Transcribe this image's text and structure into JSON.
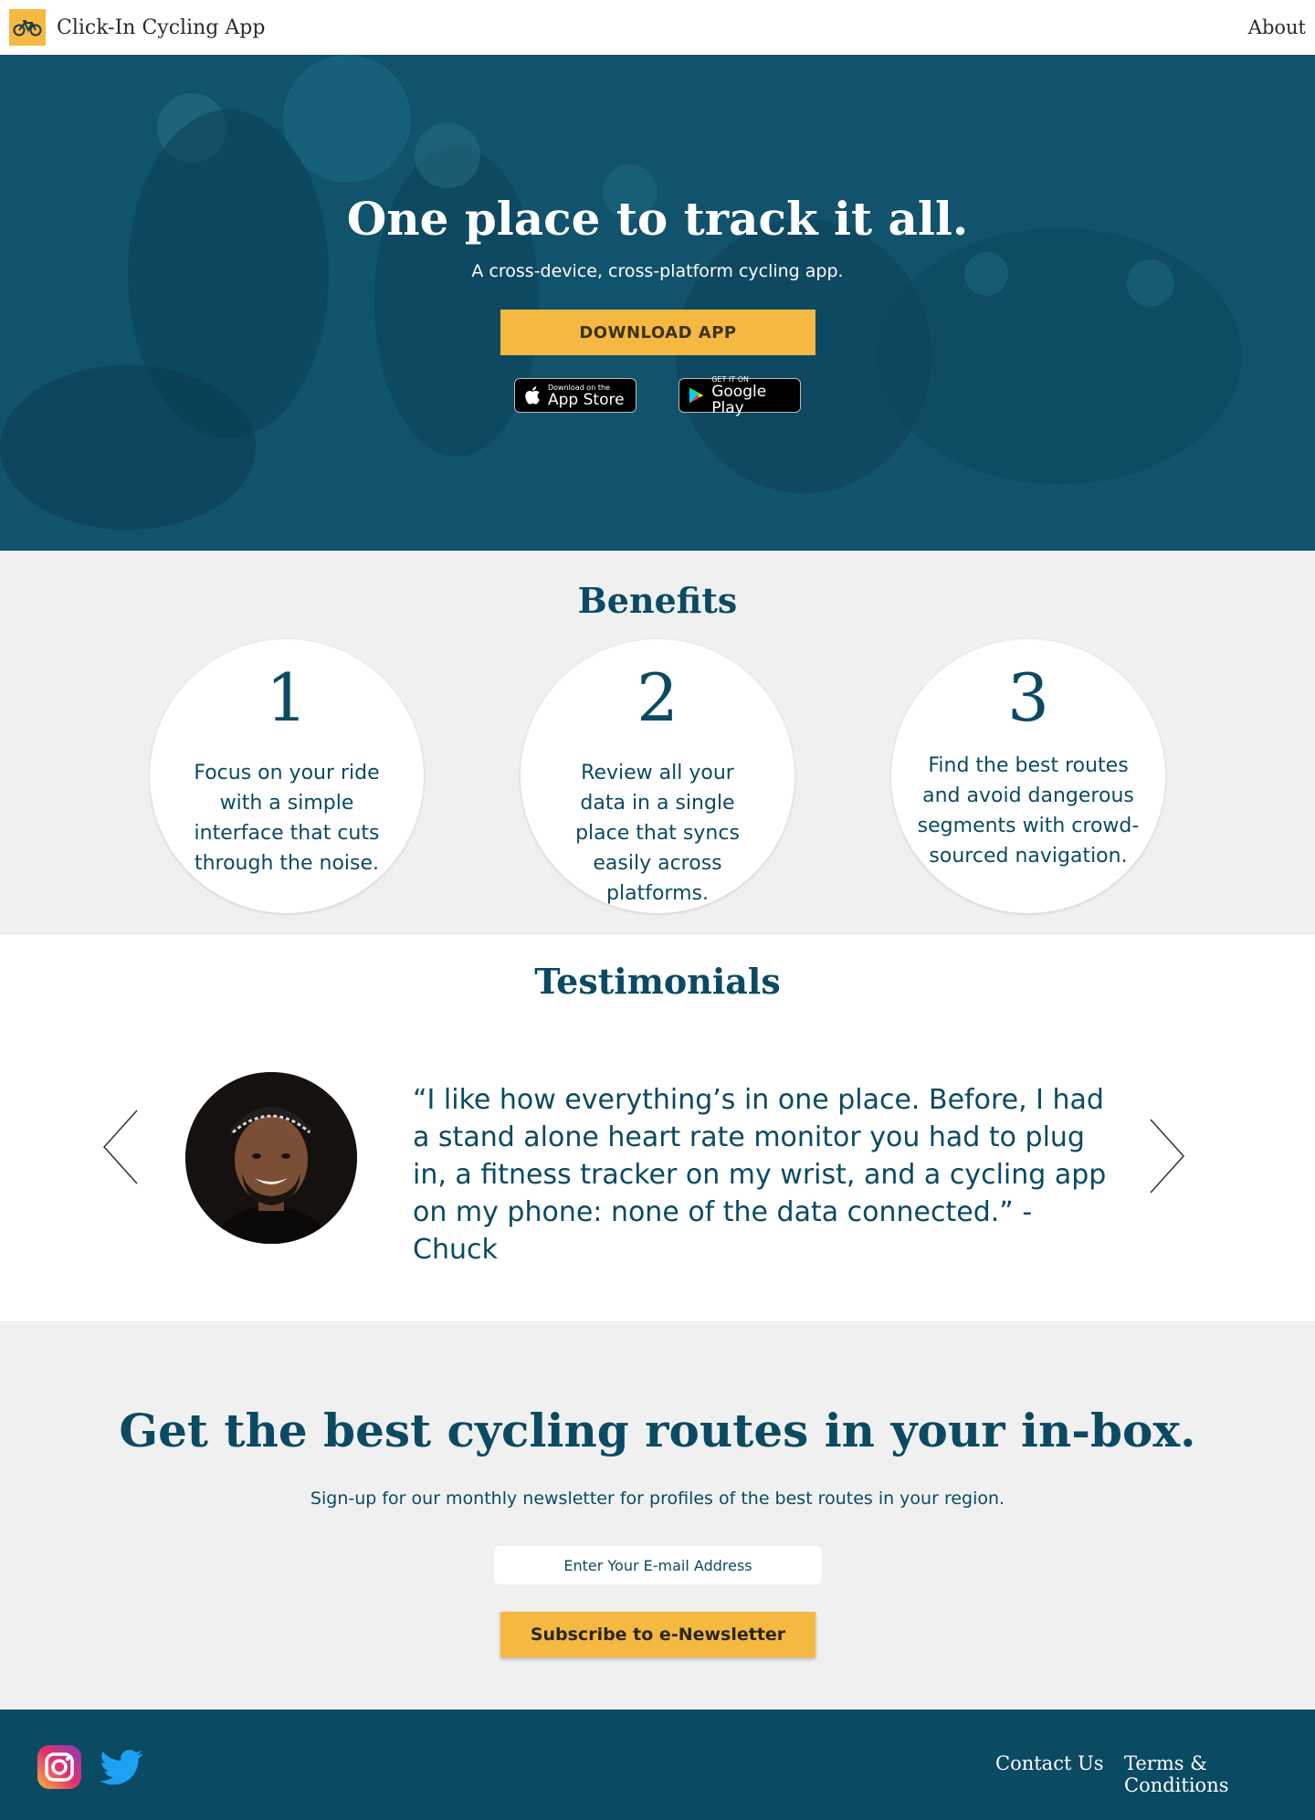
{
  "header": {
    "brand_name": "Click-In Cycling App",
    "nav_about": "About"
  },
  "hero": {
    "title": "One place to track it all.",
    "subtitle": "A cross-device, cross-platform cycling app.",
    "download_label": "DOWNLOAD APP",
    "app_store": {
      "small": "Download on the",
      "big": "App Store"
    },
    "google_play": {
      "small": "GET IT ON",
      "big": "Google Play"
    }
  },
  "benefits": {
    "title": "Benefits",
    "items": [
      {
        "number": "1",
        "text": "Focus on your ride with a simple interface that cuts through the noise."
      },
      {
        "number": "2",
        "text": "Review all your data in a single place that syncs easily across platforms."
      },
      {
        "number": "3",
        "text": "Find the best routes and avoid dangerous segments with crowd-sourced navigation."
      }
    ]
  },
  "testimonials": {
    "title": "Testimonials",
    "quote": "“I like how everything’s in one place.  Before, I had a stand alone heart rate monitor you had to plug in, a fitness tracker on my wrist, and a cycling app on my phone: none of the data connected.” - Chuck"
  },
  "newsletter": {
    "title": "Get the best cycling routes in your in-box.",
    "subtitle": "Sign-up for our monthly newsletter for profiles of the best routes in your region.",
    "email_placeholder": "Enter Your E-mail Address",
    "subscribe_label": "Subscribe to e-Newsletter"
  },
  "footer": {
    "contact_label": "Contact Us",
    "terms_label": "Terms & Conditions"
  },
  "colors": {
    "primary": "#0b4a63",
    "accent": "#f5b942",
    "light_bg": "#f0f0f0"
  },
  "icons": {
    "logo": "bicycle-icon",
    "social": [
      "instagram-icon",
      "twitter-icon"
    ],
    "arrows": [
      "chevron-left-icon",
      "chevron-right-icon"
    ]
  }
}
